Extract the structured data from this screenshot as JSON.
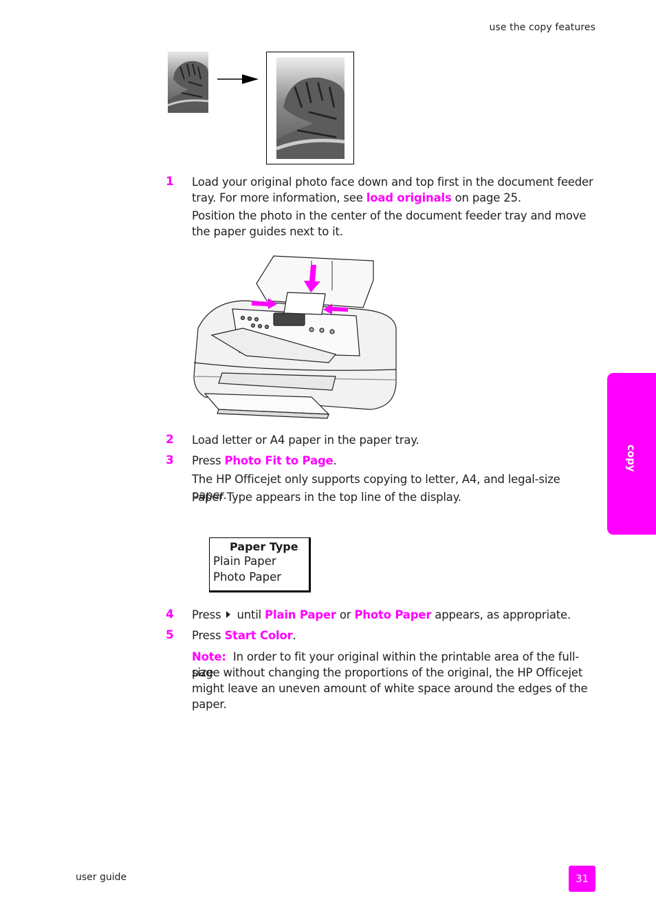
{
  "header": {
    "section_title": "use the copy features"
  },
  "figures": {
    "tiger_original": "grayscale tiger photo (original)",
    "tiger_enlarged": "grayscale tiger photo enlarged to full page",
    "printer_illustration": "HP Officejet loading photo into document feeder tray"
  },
  "steps": [
    {
      "number": "1",
      "text_before": "Load your original photo face down and top first in the document feeder tray. For more information, see ",
      "link": "load originals",
      "text_after": " on page 25.",
      "extra": "Position the photo in the center of the document feeder tray and move the paper guides next to it."
    },
    {
      "number": "2",
      "text": "Load letter or A4 paper in the paper tray."
    },
    {
      "number": "3",
      "text_before": "Press ",
      "highlight": "Photo Fit to Page",
      "text_after": ".",
      "extra1": "The HP Officejet only supports copying to letter, A4, and legal-size paper.",
      "extra2": "Paper Type appears in the top line of the display."
    },
    {
      "number": "4",
      "text_before": "Press",
      "arrow_icon": "right-arrow-button",
      "text_mid1": "until ",
      "highlight1": "Plain Paper",
      "text_mid2": " or ",
      "highlight2": "Photo Paper",
      "text_after": " appears, as appropriate."
    },
    {
      "number": "5",
      "text_before": "Press ",
      "highlight": "Start Color",
      "text_after": "."
    }
  ],
  "display": {
    "title": "Paper Type",
    "options": [
      "Plain Paper",
      "Photo Paper"
    ]
  },
  "note": {
    "label": "Note:",
    "lines": [
      "In order to fit your original within the printable area of the full-size",
      "page without changing the proportions of the original, the HP Officejet",
      "might leave an uneven amount of white space around the edges of the",
      "paper."
    ]
  },
  "side_tab": {
    "label": "copy"
  },
  "footer": {
    "guide_title": "user guide",
    "page_number": "31"
  },
  "colors": {
    "accent": "#ff00ff",
    "text": "#1f1f1f"
  }
}
